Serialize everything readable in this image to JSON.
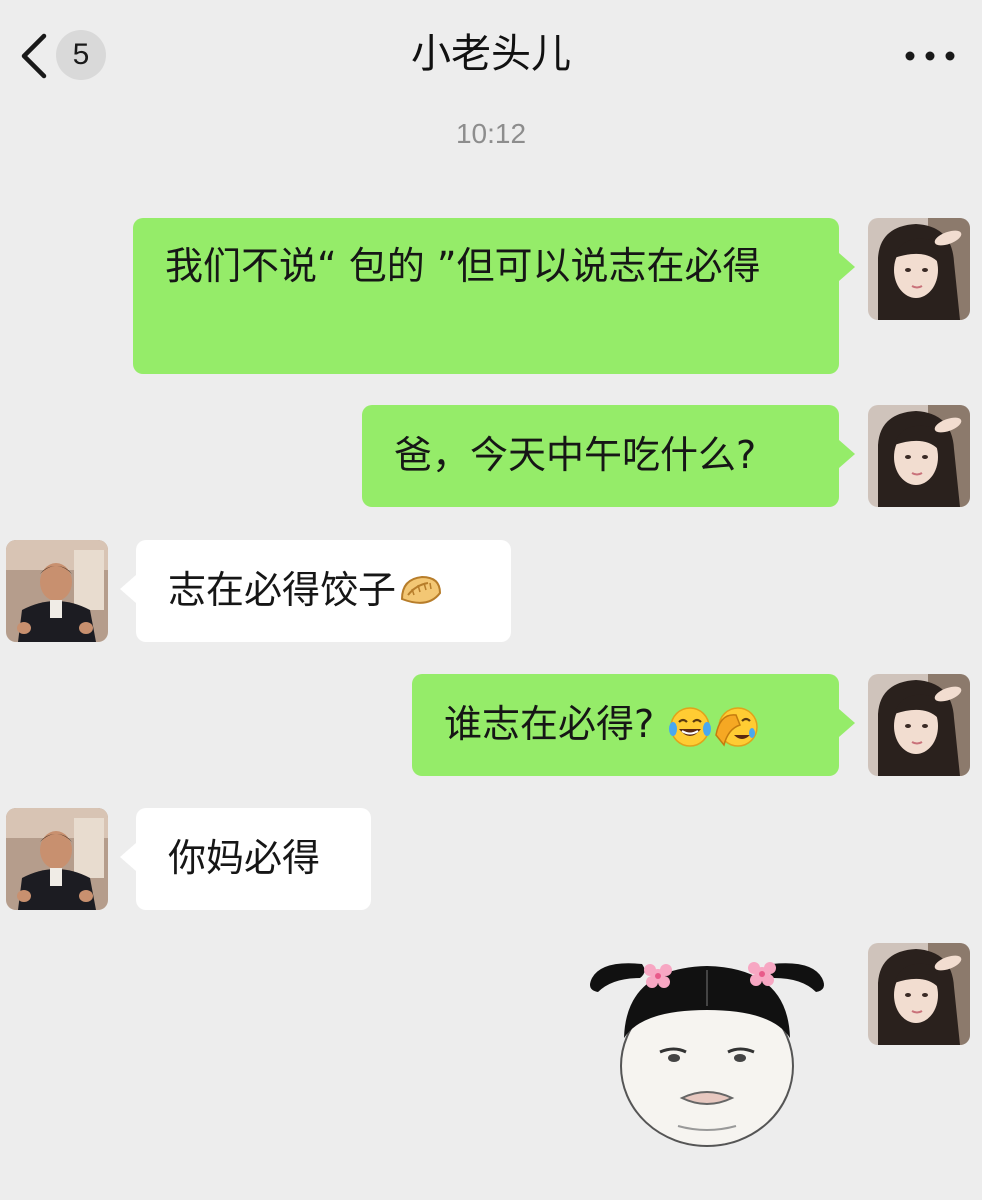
{
  "header": {
    "title": "小老头儿",
    "unread_count": "5"
  },
  "timestamp": "10:12",
  "messages": [
    {
      "from": "me",
      "text": "我们不说“ 包的 ”但可以说志在必得"
    },
    {
      "from": "me",
      "text": "爸，今天中午吃什么?"
    },
    {
      "from": "dad",
      "text": "志在必得饺子",
      "emoji": "dumpling-emoji"
    },
    {
      "from": "me",
      "text": "谁志在必得?",
      "emoji": [
        "tears-of-joy-emoji",
        "facepalm-laugh-emoji"
      ]
    },
    {
      "from": "dad",
      "text": "你妈必得"
    },
    {
      "from": "me",
      "sticker": "girl-pigtails-sticker"
    }
  ],
  "colors": {
    "background": "#ededed",
    "outgoing_bubble": "#95ec69",
    "incoming_bubble": "#ffffff"
  }
}
